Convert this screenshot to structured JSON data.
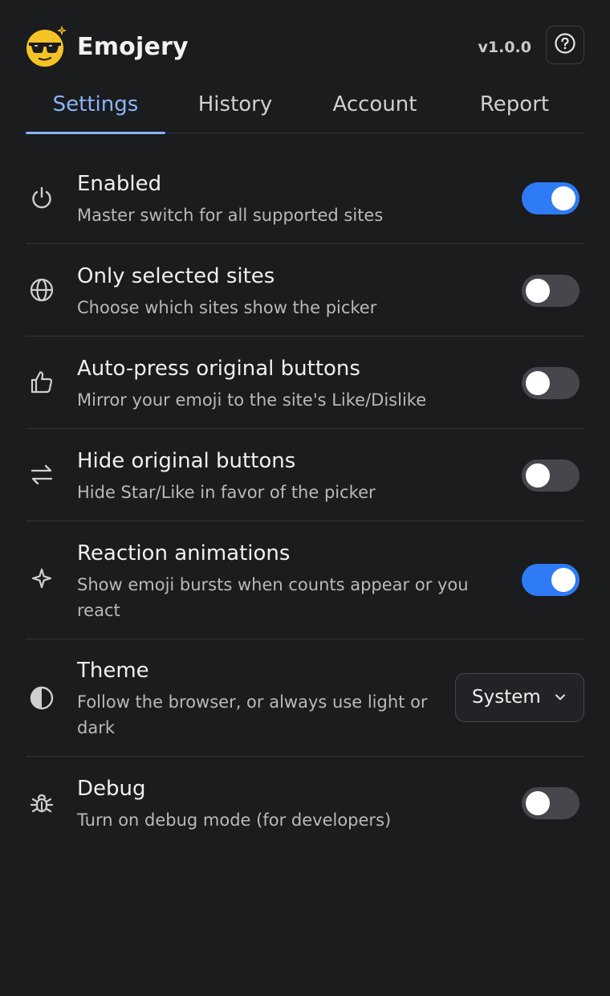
{
  "header": {
    "title": "Emojery",
    "version": "v1.0.0",
    "help_icon": "help-circle-icon",
    "logo_icon": "sunglasses-emoji-icon"
  },
  "tabs": [
    {
      "label": "Settings",
      "active": true
    },
    {
      "label": "History",
      "active": false
    },
    {
      "label": "Account",
      "active": false
    },
    {
      "label": "Report",
      "active": false
    }
  ],
  "settings": [
    {
      "icon": "power-icon",
      "title": "Enabled",
      "description": "Master switch for all supported sites",
      "control": "toggle",
      "on": true
    },
    {
      "icon": "globe-icon",
      "title": "Only selected sites",
      "description": "Choose which sites show the picker",
      "control": "toggle",
      "on": false
    },
    {
      "icon": "thumbs-up-icon",
      "title": "Auto-press original buttons",
      "description": "Mirror your emoji to the site's Like/Dislike",
      "control": "toggle",
      "on": false
    },
    {
      "icon": "swap-arrows-icon",
      "title": "Hide original buttons",
      "description": "Hide Star/Like in favor of the picker",
      "control": "toggle",
      "on": false
    },
    {
      "icon": "sparkle-icon",
      "title": "Reaction animations",
      "description": "Show emoji bursts when counts appear or you react",
      "control": "toggle",
      "on": true
    },
    {
      "icon": "contrast-icon",
      "title": "Theme",
      "description": "Follow the browser, or always use light or dark",
      "control": "select",
      "value": "System"
    },
    {
      "icon": "bug-icon",
      "title": "Debug",
      "description": "Turn on debug mode (for developers)",
      "control": "toggle",
      "on": false
    }
  ],
  "colors": {
    "background": "#1b1c1e",
    "accent": "#8ab4f8",
    "toggle_on": "#2f7bf5",
    "toggle_off": "#45474c"
  }
}
